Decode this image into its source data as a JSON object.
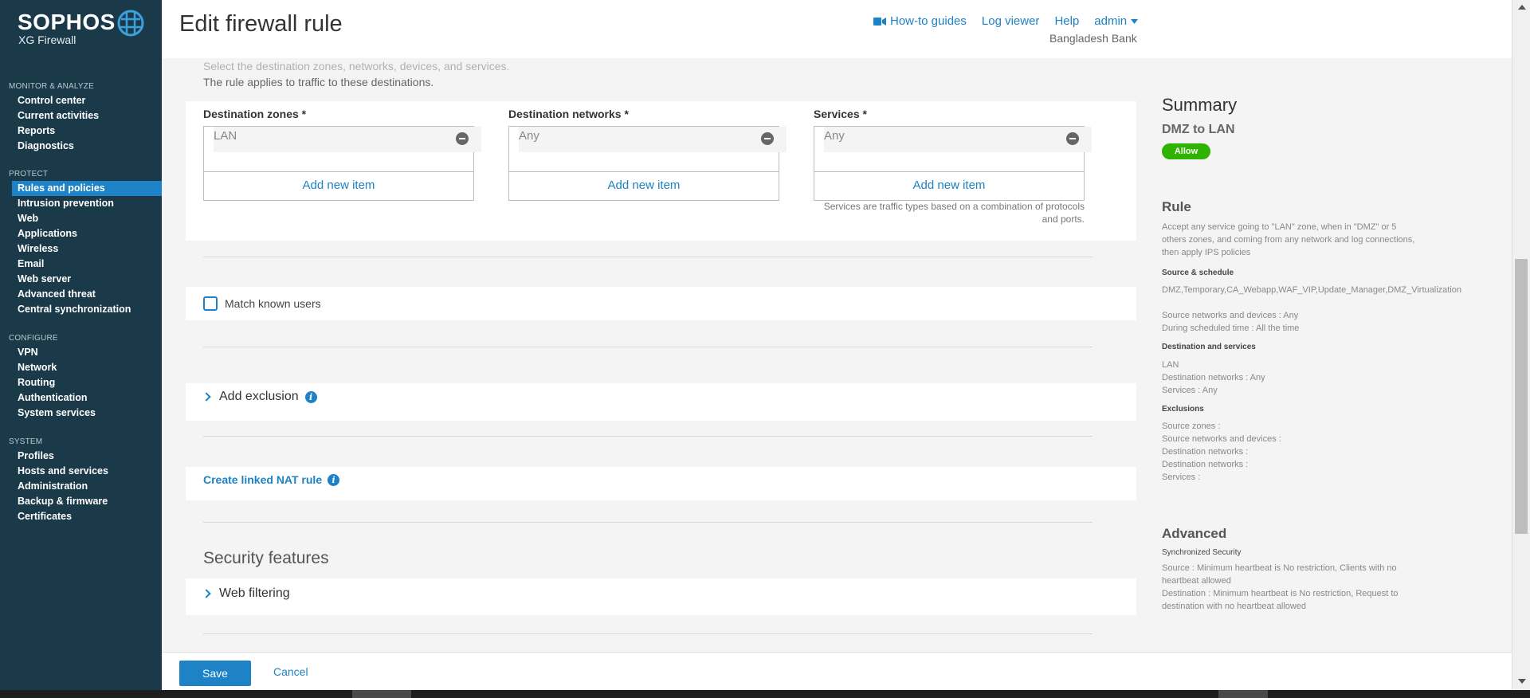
{
  "brand": {
    "name": "SOPHOS",
    "product": "XG Firewall"
  },
  "sidebar": {
    "sections": [
      {
        "heading": "MONITOR & ANALYZE",
        "items": [
          "Control center",
          "Current activities",
          "Reports",
          "Diagnostics"
        ]
      },
      {
        "heading": "PROTECT",
        "items": [
          "Rules and policies",
          "Intrusion prevention",
          "Web",
          "Applications",
          "Wireless",
          "Email",
          "Web server",
          "Advanced threat",
          "Central synchronization"
        ]
      },
      {
        "heading": "CONFIGURE",
        "items": [
          "VPN",
          "Network",
          "Routing",
          "Authentication",
          "System services"
        ]
      },
      {
        "heading": "SYSTEM",
        "items": [
          "Profiles",
          "Hosts and services",
          "Administration",
          "Backup & firmware",
          "Certificates"
        ]
      }
    ],
    "active_item": "Rules and policies"
  },
  "header": {
    "title": "Edit firewall rule",
    "links": {
      "howto": "How-to guides",
      "log": "Log viewer",
      "help": "Help",
      "user": "admin"
    },
    "org": "Bangladesh Bank"
  },
  "destination": {
    "hint_top": "Select the destination zones, networks, devices, and services.",
    "hint": "The rule applies to traffic to these destinations.",
    "zones": {
      "label": "Destination zones *",
      "value": "LAN",
      "add": "Add new item"
    },
    "networks": {
      "label": "Destination networks *",
      "value": "Any",
      "add": "Add new item"
    },
    "services": {
      "label": "Services *",
      "value": "Any",
      "add": "Add new item"
    },
    "services_note": "Services are traffic types based on a combination of protocols and ports."
  },
  "options": {
    "match_known_users": "Match known users",
    "add_exclusion": "Add exclusion",
    "create_nat": "Create linked NAT rule"
  },
  "security": {
    "title": "Security features",
    "web_filtering": "Web filtering"
  },
  "summary": {
    "title": "Summary",
    "rule_name": "DMZ to LAN",
    "action": "Allow",
    "rule_heading": "Rule",
    "rule_desc": "Accept any service going to \"LAN\" zone, when in \"DMZ\" or 5 others zones, and coming from any network and log connections, then apply IPS policies",
    "source_heading": "Source & schedule",
    "source_lines": [
      "DMZ,Temporary,CA_Webapp,WAF_VIP,Update_Manager,DMZ_Virtualization",
      "Source networks and devices : Any",
      "During scheduled time : All the time"
    ],
    "dest_heading": "Destination and services",
    "dest_lines": [
      "LAN",
      "Destination networks : Any",
      "Services : Any"
    ],
    "excl_heading": "Exclusions",
    "excl_lines": [
      "Source zones :",
      "Source networks and devices :",
      "Destination networks :",
      "Destination networks :",
      "Services :"
    ],
    "adv_heading": "Advanced",
    "sync_heading": "Synchronized Security",
    "sync_lines": [
      "Source : Minimum heartbeat is No restriction, Clients with no heartbeat allowed",
      "Destination : Minimum heartbeat is No restriction, Request to destination with no heartbeat allowed"
    ]
  },
  "footer": {
    "save": "Save",
    "cancel": "Cancel"
  },
  "colors": {
    "sidebar_bg": "#1a3a4a",
    "accent": "#1d82c6",
    "allow": "#2db300"
  }
}
